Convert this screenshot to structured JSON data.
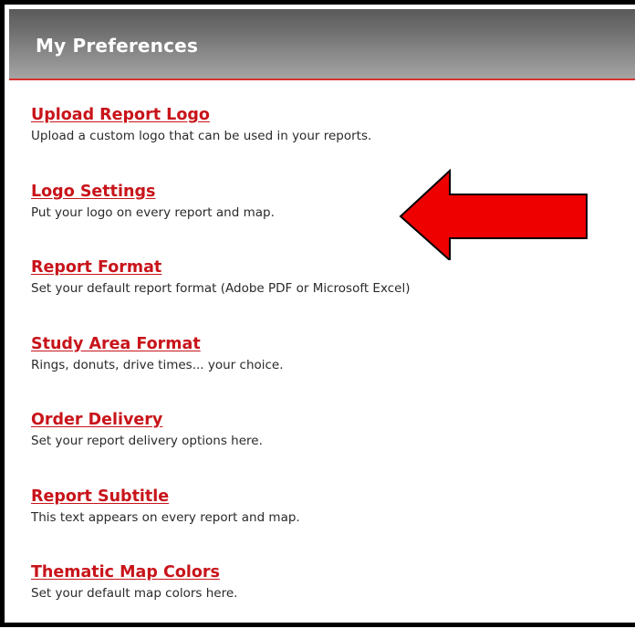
{
  "header": {
    "title": "My Preferences"
  },
  "items": [
    {
      "label": "Upload Report Logo",
      "description": "Upload a custom logo that can be used in your reports."
    },
    {
      "label": "Logo Settings",
      "description": "Put your logo on every report and map."
    },
    {
      "label": "Report Format",
      "description": "Set your default report format (Adobe PDF or Microsoft Excel)"
    },
    {
      "label": "Study Area Format",
      "description": "Rings, donuts, drive times... your choice."
    },
    {
      "label": "Order Delivery",
      "description": "Set your report delivery options here."
    },
    {
      "label": "Report Subtitle",
      "description": "This text appears on every report and map."
    },
    {
      "label": "Thematic Map Colors",
      "description": "Set your default map colors here."
    }
  ],
  "annotation": {
    "arrow_color": "#ee0000",
    "arrow_icon": "left-arrow-icon"
  },
  "colors": {
    "link": "#c8141a",
    "header_underline": "#d83232"
  }
}
